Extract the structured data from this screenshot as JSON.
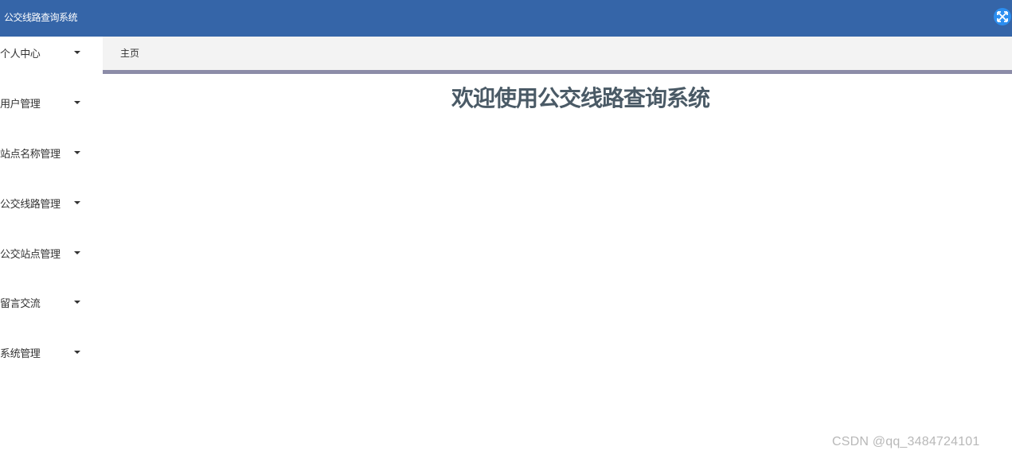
{
  "header": {
    "title": "公交线路查询系统",
    "fullscreen_icon": "fullscreen-icon",
    "accent": "#3565a8"
  },
  "sidebar": {
    "items": [
      {
        "label": "个人中心",
        "icon": "caret-down-icon"
      },
      {
        "label": "用户管理",
        "icon": "caret-down-icon"
      },
      {
        "label": "站点名称管理",
        "icon": "caret-down-icon"
      },
      {
        "label": "公交线路管理",
        "icon": "caret-down-icon"
      },
      {
        "label": "公交站点管理",
        "icon": "caret-down-icon"
      },
      {
        "label": "留言交流",
        "icon": "caret-down-icon"
      },
      {
        "label": "系统管理",
        "icon": "caret-down-icon"
      }
    ]
  },
  "tabs": [
    {
      "label": "主页",
      "active": true
    }
  ],
  "main": {
    "welcome_text": "欢迎使用公交线路查询系统"
  },
  "watermark": "CSDN @qq_3484724101"
}
